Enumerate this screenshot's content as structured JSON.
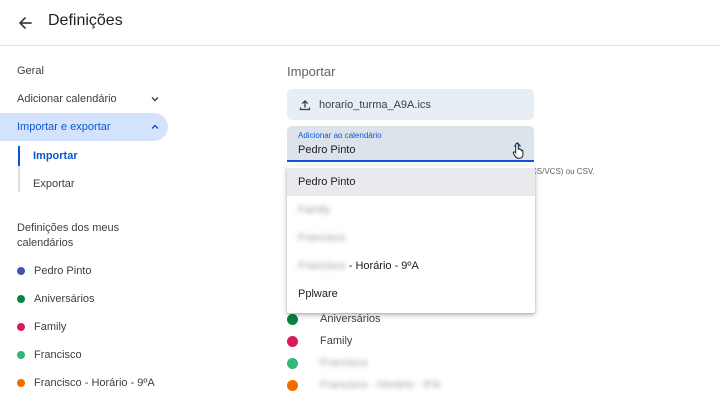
{
  "header": {
    "title": "Definições"
  },
  "sidebar": {
    "items": [
      {
        "label": "Geral"
      },
      {
        "label": "Adicionar calendário"
      },
      {
        "label": "Importar e exportar"
      }
    ],
    "sub_items": [
      {
        "label": "Importar"
      },
      {
        "label": "Exportar"
      }
    ],
    "section_label": "Definições dos meus calendários",
    "calendars": [
      {
        "label": "Pedro Pinto",
        "color": "#3f51b5"
      },
      {
        "label": "Aniversários",
        "color": "#0b8043"
      },
      {
        "label": "Family",
        "color": "#d81b60"
      },
      {
        "label": "Francisco",
        "color": "#33b679"
      },
      {
        "label": "Francisco - Horário - 9ºA",
        "color": "#ef6c00"
      }
    ]
  },
  "main": {
    "title": "Importar",
    "file_name": "horario_turma_A9A.ics",
    "select": {
      "label": "Adicionar ao calendário",
      "value": "Pedro Pinto"
    },
    "hint_text": "CS/VCS) ou CSV.",
    "dropdown": {
      "options": [
        {
          "label": "Pedro Pinto"
        },
        {
          "label": "Family"
        },
        {
          "label": "Francisco"
        },
        {
          "label_blurred": "Francisco",
          "label_suffix": " - Horário - 9ºA"
        },
        {
          "label": "Pplware"
        }
      ]
    },
    "calendars": [
      {
        "label": "Aniversários",
        "color": "#0b8043"
      },
      {
        "label": "Family",
        "color": "#d81b60"
      },
      {
        "label": "Francisco",
        "color": "#33b679"
      },
      {
        "label": "Francisco - Horário - 9ºA",
        "color": "#ef6c00"
      }
    ]
  }
}
